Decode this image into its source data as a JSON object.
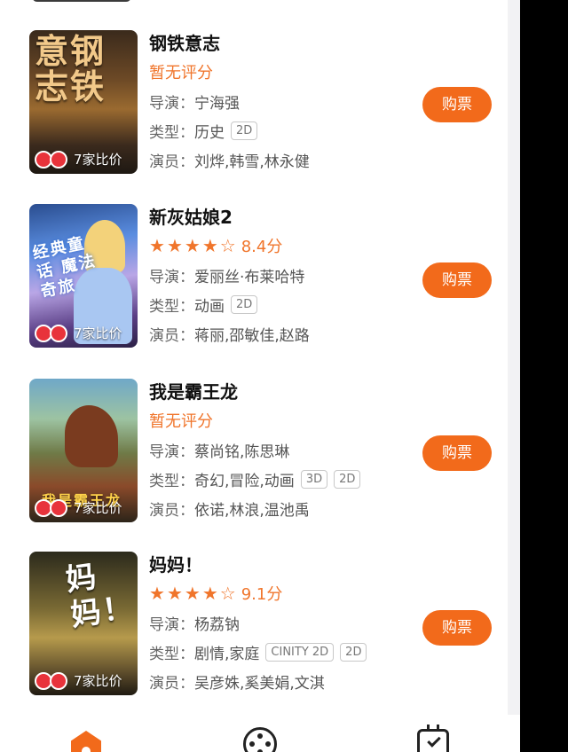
{
  "movies": [
    {
      "title": "钢铁意志",
      "poster_title": "意钢 志铁",
      "rating_text": "暂无评分",
      "director_label": "导演：",
      "director": "宁海强",
      "genre_label": "类型：",
      "genre": "历史",
      "formats": [
        "2D"
      ],
      "cast_label": "演员：",
      "cast": "刘烨,韩雪,林永健",
      "compare_text": "7家比价",
      "buy_label": "购票"
    },
    {
      "title": "新灰姑娘2",
      "poster_title": "经典童话 魔法奇旅",
      "stars": 4.5,
      "rating_text": "8.4分",
      "director_label": "导演：",
      "director": "爱丽丝·布莱哈特",
      "genre_label": "类型：",
      "genre": "动画",
      "formats": [
        "2D"
      ],
      "cast_label": "演员：",
      "cast": "蒋丽,邵敏佳,赵路",
      "compare_text": "7家比价",
      "buy_label": "购票"
    },
    {
      "title": "我是霸王龙",
      "poster_title": "我是霸王龙",
      "rating_text": "暂无评分",
      "director_label": "导演：",
      "director": "蔡尚铭,陈思琳",
      "genre_label": "类型：",
      "genre": "奇幻,冒险,动画",
      "formats": [
        "3D",
        "2D"
      ],
      "cast_label": "演员：",
      "cast": "依诺,林浪,温池禹",
      "compare_text": "7家比价",
      "buy_label": "购票"
    },
    {
      "title": "妈妈！",
      "poster_title": "妈妈！",
      "stars": 4.5,
      "rating_text": "9.1分",
      "director_label": "导演：",
      "director": "杨荔钠",
      "genre_label": "类型：",
      "genre": "剧情,家庭",
      "formats": [
        "CINITY 2D",
        "2D"
      ],
      "cast_label": "演员：",
      "cast": "吴彦姝,奚美娟,文淇",
      "compare_text": "7家比价",
      "buy_label": "购票"
    }
  ],
  "tabbar": {
    "items": [
      {
        "icon": "home-icon",
        "active": true
      },
      {
        "icon": "film-reel-icon",
        "active": false
      },
      {
        "icon": "calendar-check-icon",
        "active": false
      }
    ]
  },
  "colors": {
    "accent": "#f26a1b",
    "text": "#111111",
    "muted": "#666666"
  }
}
